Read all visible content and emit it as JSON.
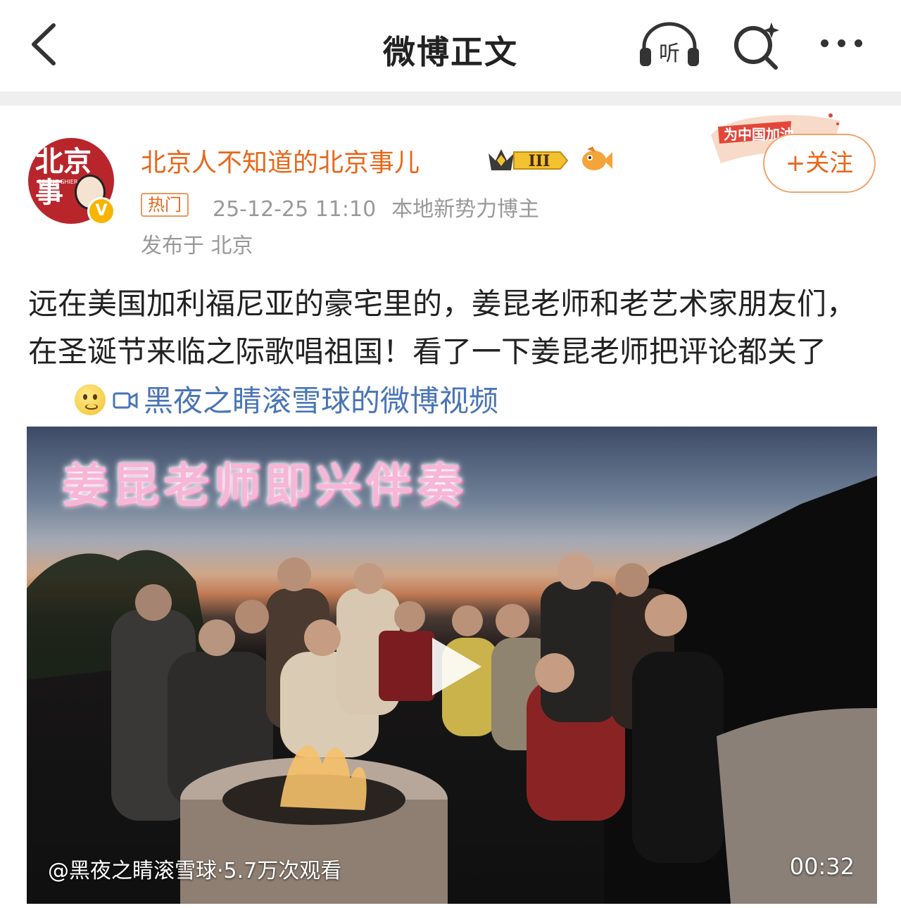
{
  "nav": {
    "title": "微博正文",
    "listen_label": "听"
  },
  "post": {
    "author": {
      "name": "北京人不知道的北京事儿",
      "avatar_text": "北京事",
      "avatar_subtext": "BEIJING SHIER",
      "level_badge": "III",
      "verified_mark": "V"
    },
    "hot_tag": "热门",
    "timestamp": "25-12-25 11:10",
    "role": "本地新势力博主",
    "location": "发布于 北京",
    "follow_label": "+关注",
    "follow_badge_text": "为中国加油",
    "text": "远在美国加利福尼亚的豪宅里的，姜昆老师和老艺术家朋友们，在圣诞节来临之际歌唱祖国！看了一下姜昆老师把评论都关了",
    "video_link": "黑夜之睛滚雪球的微博视频"
  },
  "video": {
    "overlay_title": "姜昆老师即兴伴奏",
    "credit": "@黑夜之睛滚雪球·5.7万次观看",
    "duration": "00:32"
  },
  "colors": {
    "accent_orange": "#e8661a",
    "link_blue": "#4a75b6",
    "avatar_red": "#b8262c",
    "meta_gray": "#999999"
  }
}
